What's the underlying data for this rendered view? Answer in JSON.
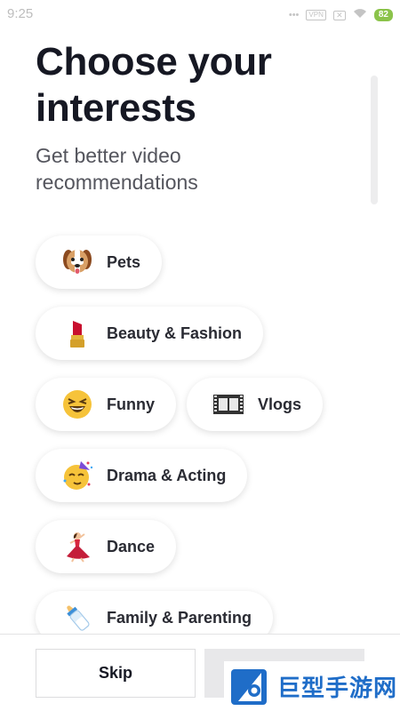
{
  "status_bar": {
    "time": "9:25",
    "icons": [
      "dots-icon",
      "vpn-icon",
      "sim-x-icon",
      "wifi-icon"
    ],
    "vpn_label": "VPN",
    "battery": "82"
  },
  "header": {
    "title": "Choose your interests",
    "subtitle": "Get better video recommendations"
  },
  "interests": [
    {
      "label": "Pets",
      "icon": "dog-face-icon"
    },
    {
      "label": "Beauty & Fashion",
      "icon": "lipstick-icon"
    },
    {
      "label": "Funny",
      "icon": "laughing-face-icon"
    },
    {
      "label": "Vlogs",
      "icon": "film-frames-icon"
    },
    {
      "label": "Drama & Acting",
      "icon": "partying-face-icon"
    },
    {
      "label": "Dance",
      "icon": "dancer-icon"
    },
    {
      "label": "Family & Parenting",
      "icon": "baby-bottle-icon"
    }
  ],
  "footer": {
    "skip_label": "Skip"
  },
  "watermark": {
    "text": "巨型手游网"
  },
  "colors": {
    "text_primary": "#161823",
    "text_secondary": "#54555d",
    "battery": "#8bc34a",
    "next_button_disabled": "#e8e8ea",
    "watermark_blue": "#1f6dc8"
  }
}
